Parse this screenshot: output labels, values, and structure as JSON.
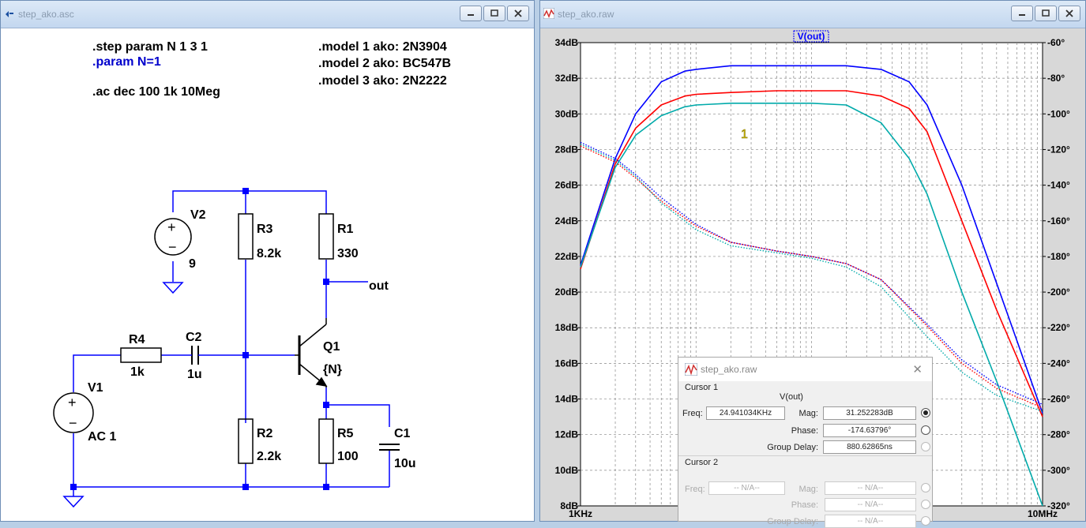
{
  "schematic_window": {
    "title": "step_ako.asc",
    "directives": [
      ".step param N 1 3 1",
      ".param N=1",
      ".ac dec 100 1k 10Meg"
    ],
    "models": [
      ".model 1 ako: 2N3904",
      ".model 2 ako: BC547B",
      ".model 3 ako: 2N2222"
    ],
    "components": {
      "V2": {
        "name": "V2",
        "value": "9"
      },
      "R3": {
        "name": "R3",
        "value": "8.2k"
      },
      "R1": {
        "name": "R1",
        "value": "330"
      },
      "R4": {
        "name": "R4",
        "value": "1k"
      },
      "C2": {
        "name": "C2",
        "value": "1u"
      },
      "Q1": {
        "name": "Q1",
        "value": "{N}"
      },
      "V1": {
        "name": "V1",
        "value": "AC 1"
      },
      "R2": {
        "name": "R2",
        "value": "2.2k"
      },
      "R5": {
        "name": "R5",
        "value": "100"
      },
      "C1": {
        "name": "C1",
        "value": "10u"
      }
    },
    "net_label": "out"
  },
  "waveform_window": {
    "title": "step_ako.raw",
    "trace_label": "V(out)",
    "cursor_marker": "1"
  },
  "chart_data": {
    "type": "line",
    "title": "V(out)",
    "x_scale": "log",
    "xlim": [
      1000,
      10000000
    ],
    "x_tick_labels": [
      "1KHz",
      "10MHz"
    ],
    "y_left_ticks": [
      "8dB",
      "10dB",
      "12dB",
      "14dB",
      "16dB",
      "18dB",
      "20dB",
      "22dB",
      "24dB",
      "26dB",
      "28dB",
      "30dB",
      "32dB",
      "34dB"
    ],
    "ylim_left": [
      8,
      34
    ],
    "y_right_ticks": [
      "-320°",
      "-300°",
      "-280°",
      "-260°",
      "-240°",
      "-220°",
      "-200°",
      "-180°",
      "-160°",
      "-140°",
      "-120°",
      "-100°",
      "-80°",
      "-60°"
    ],
    "ylim_right": [
      -320,
      -60
    ],
    "grid": true,
    "series": [
      {
        "color": "#0000ff",
        "kind": "magnitude",
        "x": [
          1000,
          2000,
          3000,
          5000,
          8000,
          10000,
          20000,
          50000,
          100000,
          200000,
          400000,
          700000,
          1000000,
          2000000,
          4000000,
          10000000
        ],
        "y": [
          21.5,
          27.5,
          30.0,
          31.8,
          32.4,
          32.5,
          32.7,
          32.7,
          32.7,
          32.7,
          32.5,
          31.8,
          30.5,
          26.0,
          20.5,
          13.2
        ]
      },
      {
        "color": "#ff0000",
        "kind": "magnitude",
        "x": [
          1000,
          2000,
          3000,
          5000,
          8000,
          10000,
          20000,
          50000,
          100000,
          200000,
          400000,
          700000,
          1000000,
          2000000,
          4000000,
          10000000
        ],
        "y": [
          21.3,
          27.2,
          29.2,
          30.5,
          31.0,
          31.1,
          31.2,
          31.3,
          31.3,
          31.3,
          31.0,
          30.3,
          29.0,
          24.0,
          19.0,
          13.0
        ]
      },
      {
        "color": "#00aaaa",
        "kind": "magnitude",
        "x": [
          1000,
          2000,
          3000,
          5000,
          8000,
          10000,
          20000,
          50000,
          100000,
          200000,
          400000,
          700000,
          1000000,
          2000000,
          4000000,
          10000000
        ],
        "y": [
          21.4,
          27.0,
          28.8,
          29.9,
          30.4,
          30.5,
          30.6,
          30.6,
          30.6,
          30.5,
          29.5,
          27.5,
          25.5,
          20.0,
          15.0,
          8.0
        ]
      },
      {
        "color": "#0000ff",
        "kind": "phase",
        "x": [
          1000,
          2000,
          3000,
          5000,
          10000,
          20000,
          50000,
          100000,
          200000,
          400000,
          1000000,
          2000000,
          4000000,
          10000000
        ],
        "y": [
          -116,
          -125,
          -134,
          -147,
          -162,
          -172,
          -177,
          -180,
          -184,
          -193,
          -218,
          -238,
          -252,
          -263
        ]
      },
      {
        "color": "#ff0000",
        "kind": "phase",
        "x": [
          1000,
          2000,
          3000,
          5000,
          10000,
          20000,
          50000,
          100000,
          200000,
          400000,
          1000000,
          2000000,
          4000000,
          10000000
        ],
        "y": [
          -118,
          -127,
          -136,
          -149,
          -163,
          -172,
          -177,
          -180,
          -184,
          -193,
          -219,
          -240,
          -254,
          -265
        ]
      },
      {
        "color": "#00aaaa",
        "kind": "phase",
        "x": [
          1000,
          2000,
          3000,
          5000,
          10000,
          20000,
          50000,
          100000,
          200000,
          400000,
          1000000,
          2000000,
          4000000,
          10000000
        ],
        "y": [
          -117,
          -126,
          -135,
          -150,
          -165,
          -174,
          -178,
          -181,
          -186,
          -197,
          -225,
          -245,
          -258,
          -267
        ]
      }
    ]
  },
  "cursor_dialog": {
    "title": "step_ako.raw",
    "cursor1": {
      "heading": "Cursor 1",
      "trace": "V(out)",
      "freq_label": "Freq:",
      "freq_value": "24.941034KHz",
      "mag_label": "Mag:",
      "mag_value": "31.252283dB",
      "phase_label": "Phase:",
      "phase_value": "-174.63796°",
      "gd_label": "Group Delay:",
      "gd_value": "880.62865ns"
    },
    "cursor2": {
      "heading": "Cursor 2",
      "freq_label": "Freq:",
      "freq_value": "-- N/A--",
      "mag_label": "Mag:",
      "mag_value": "-- N/A--",
      "phase_label": "Phase:",
      "phase_value": "-- N/A--",
      "gd_label": "Group Delay:",
      "gd_value": "-- N/A--"
    }
  },
  "colors": {
    "wire": "#0000ff",
    "component": "#000000",
    "param_directive": "#0000cc",
    "plot_bg": "#ffffff",
    "grid": "#888888"
  }
}
